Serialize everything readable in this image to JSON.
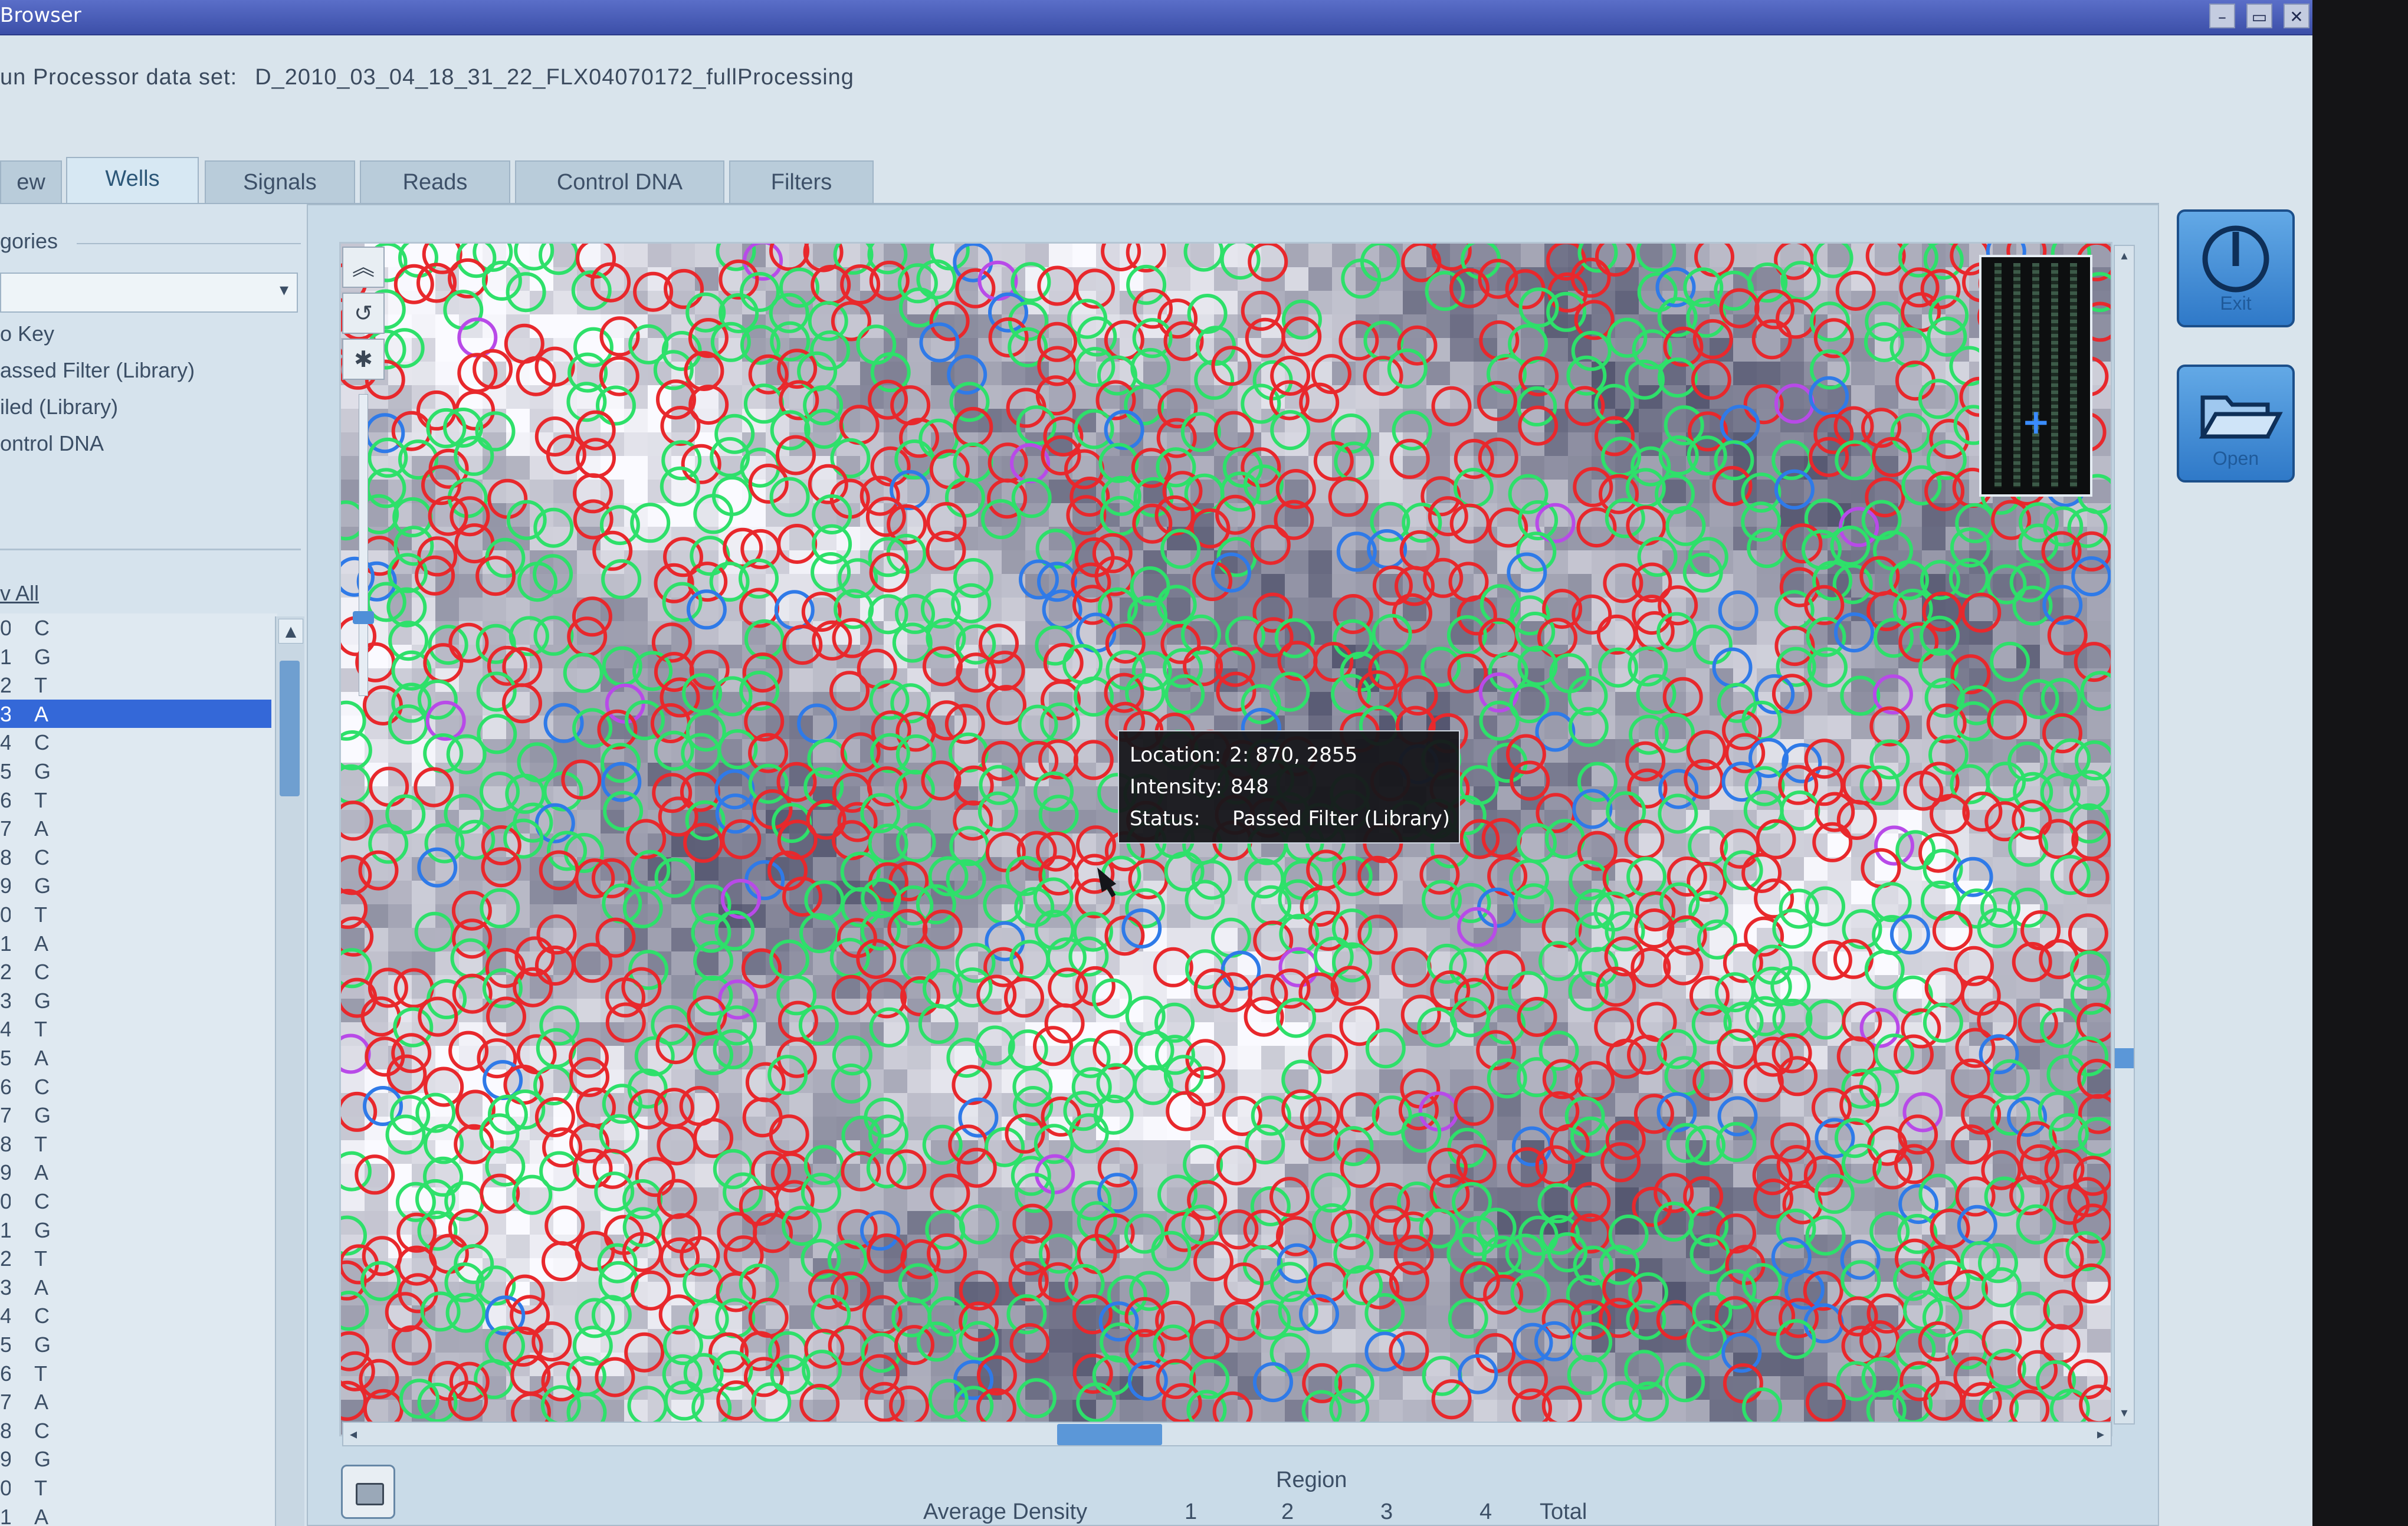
{
  "window": {
    "title": "Browser",
    "controls": [
      "–",
      "▭",
      "✕"
    ]
  },
  "dataset": {
    "label": "un Processor data set:",
    "value": "D_2010_03_04_18_31_22_FLX04070172_fullProcessing"
  },
  "tabs": [
    {
      "label": "ew"
    },
    {
      "label": "Wells",
      "active": true
    },
    {
      "label": "Signals"
    },
    {
      "label": "Reads"
    },
    {
      "label": "Control DNA"
    },
    {
      "label": "Filters"
    }
  ],
  "left_panel": {
    "categories_heading": "gories",
    "legend_items": [
      "o Key",
      "assed Filter (Library)",
      "iled (Library)",
      "ontrol DNA"
    ],
    "flow_heading": "v All",
    "flows": [
      {
        "n": "0",
        "b": "C"
      },
      {
        "n": "1",
        "b": "G"
      },
      {
        "n": "2",
        "b": "T"
      },
      {
        "n": "3",
        "b": "A",
        "selected": true
      },
      {
        "n": "4",
        "b": "C"
      },
      {
        "n": "5",
        "b": "G"
      },
      {
        "n": "6",
        "b": "T"
      },
      {
        "n": "7",
        "b": "A"
      },
      {
        "n": "8",
        "b": "C"
      },
      {
        "n": "9",
        "b": "G"
      },
      {
        "n": "0",
        "b": "T"
      },
      {
        "n": "1",
        "b": "A"
      },
      {
        "n": "2",
        "b": "C"
      },
      {
        "n": "3",
        "b": "G"
      },
      {
        "n": "4",
        "b": "T"
      },
      {
        "n": "5",
        "b": "A"
      },
      {
        "n": "6",
        "b": "C"
      },
      {
        "n": "7",
        "b": "G"
      },
      {
        "n": "8",
        "b": "T"
      },
      {
        "n": "9",
        "b": "A"
      },
      {
        "n": "0",
        "b": "C"
      },
      {
        "n": "1",
        "b": "G"
      },
      {
        "n": "2",
        "b": "T"
      },
      {
        "n": "3",
        "b": "A"
      },
      {
        "n": "4",
        "b": "C"
      },
      {
        "n": "5",
        "b": "G"
      },
      {
        "n": "6",
        "b": "T"
      },
      {
        "n": "7",
        "b": "A"
      },
      {
        "n": "8",
        "b": "C"
      },
      {
        "n": "9",
        "b": "G"
      },
      {
        "n": "0",
        "b": "T"
      },
      {
        "n": "1",
        "b": "A"
      }
    ]
  },
  "viewer": {
    "colors": {
      "passed": "#2ee06a",
      "failed": "#e8282c",
      "control": "#2f7ae8",
      "key": "#b84ae8",
      "background_dark": "#5a5d74",
      "background_light": "#f4f4ff"
    },
    "tooltip": {
      "location_label": "Location:",
      "location_value": "2: 870, 2855",
      "intensity_label": "Intensity:",
      "intensity_value": "848",
      "status_label": "Status:",
      "status_value": "Passed Filter (Library)"
    },
    "nav_icons": [
      "double-chevron-up-icon",
      "rotate-icon",
      "bug-icon"
    ]
  },
  "actions": [
    {
      "name": "exit-button",
      "label": "Exit",
      "icon": "power-icon"
    },
    {
      "name": "open-button",
      "label": "Open",
      "icon": "folder-open-icon"
    }
  ],
  "region_stats": {
    "title": "Region",
    "row_label": "Average Density",
    "columns": [
      "1",
      "2",
      "3",
      "4",
      "Total"
    ]
  }
}
